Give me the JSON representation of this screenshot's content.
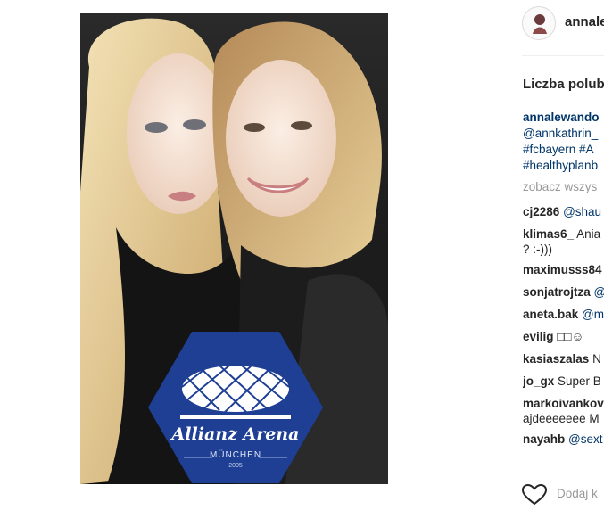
{
  "photo": {
    "badge_title": "Allianz Arena",
    "badge_city": "MÜNCHEN",
    "badge_year": "2005",
    "badge_color": "#1f3f95"
  },
  "post": {
    "username": "annale",
    "likes_label": "Liczba polubie",
    "caption_user": "annalewando",
    "caption_lines": [
      "@annkathrin_",
      "#fcbayern #A",
      "#healthyplanb"
    ],
    "view_all": "zobacz wszys"
  },
  "comments": [
    {
      "user": "cj2286",
      "text": "@shau",
      "mention": true
    },
    {
      "user": "klimas6_",
      "text": "Ania",
      "second_line": "? :-)))"
    },
    {
      "user": "maximusss84",
      "text": ""
    },
    {
      "user": "sonjatrojtza",
      "text": "@",
      "mention": true
    },
    {
      "user": "aneta.bak",
      "text": "@mo",
      "mention": true
    },
    {
      "user": "evilig",
      "text": "□□☺"
    },
    {
      "user": "kasiaszalas",
      "text": "N"
    },
    {
      "user": "jo_gx",
      "text": "Super B"
    },
    {
      "user": "markoivankov",
      "text": "",
      "second_line": "ajdeeeeeee M"
    },
    {
      "user": "nayahb",
      "text": "@sext",
      "mention": true
    }
  ],
  "actions": {
    "like_icon": "heart-icon",
    "add_comment": "Dodaj k"
  }
}
